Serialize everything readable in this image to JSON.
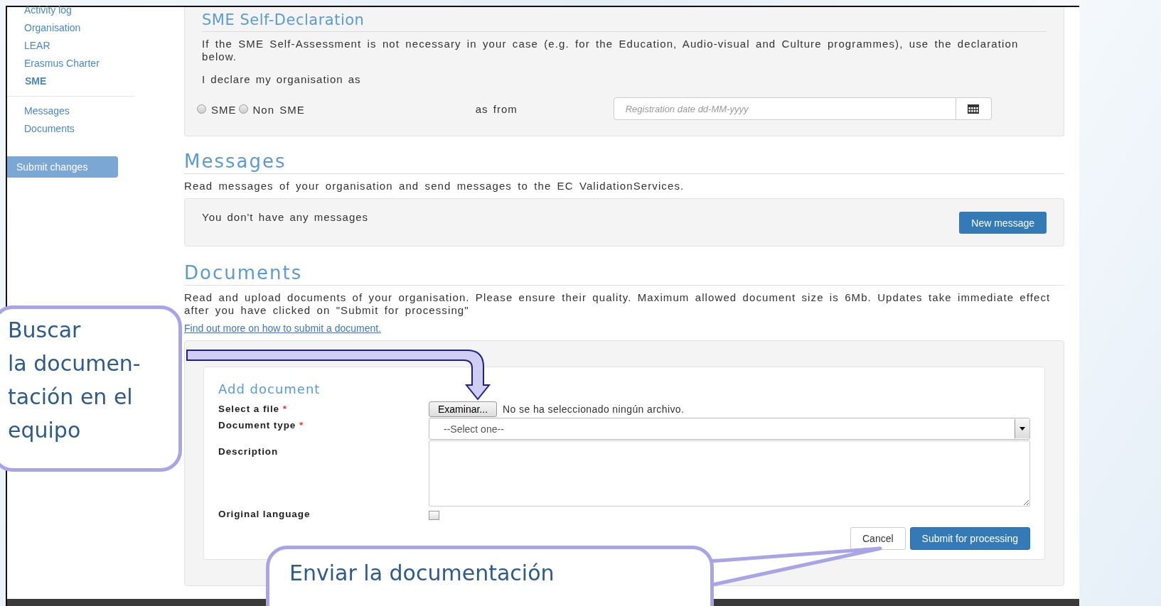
{
  "sidebar": {
    "items": [
      {
        "label": "Activity log",
        "selected": false
      },
      {
        "label": "Organisation",
        "selected": false
      },
      {
        "label": "LEAR",
        "selected": false
      },
      {
        "label": "Erasmus Charter",
        "selected": false
      },
      {
        "label": "SME",
        "selected": true
      }
    ],
    "secondary_items": [
      {
        "label": "Messages",
        "selected": false
      },
      {
        "label": "Documents",
        "selected": false
      }
    ],
    "submit_button": "Submit changes"
  },
  "sme_declaration": {
    "title": "SME Self-Declaration",
    "intro": "If the SME Self-Assessment is not necessary in your case (e.g. for the Education, Audio-visual and Culture programmes), use the declaration below.",
    "declare_label": "I declare my organisation as",
    "options": [
      {
        "label": "SME",
        "selected": false
      },
      {
        "label": "Non SME",
        "selected": false
      }
    ],
    "as_from_label": "as from",
    "date_field": {
      "placeholder": "Registration date dd-MM-yyyy"
    }
  },
  "messages": {
    "title": "Messages",
    "description": "Read messages of your organisation and send messages to the EC ValidationServices.",
    "empty_text": "You don't have any messages",
    "new_button": "New message"
  },
  "documents": {
    "title": "Documents",
    "description": "Read and upload documents of your organisation. Please ensure their quality. Maximum allowed document size is 6Mb. Updates take immediate effect after you have clicked on \"Submit for processing\"",
    "link": "Find out more on how to submit a document.",
    "add_document": {
      "title": "Add document",
      "fields": [
        {
          "kind": "file",
          "label": "Select a file",
          "required_mark": "*",
          "button": "Examinar...",
          "status": "No se ha seleccionado ningún archivo."
        },
        {
          "kind": "select",
          "label": "Document type",
          "required_mark": "*",
          "value": "--Select one--"
        },
        {
          "kind": "textarea",
          "label": "Description"
        },
        {
          "kind": "checkbox",
          "label": "Original language",
          "checked": false
        }
      ],
      "buttons": [
        {
          "label": "Cancel",
          "primary": false
        },
        {
          "label": "Submit for processing",
          "primary": true
        }
      ]
    }
  },
  "callouts": [
    {
      "lines": [
        "Buscar",
        "la documen-",
        "tación en el",
        "equipo"
      ]
    },
    {
      "lines": [
        "Enviar la documentación"
      ]
    }
  ]
}
